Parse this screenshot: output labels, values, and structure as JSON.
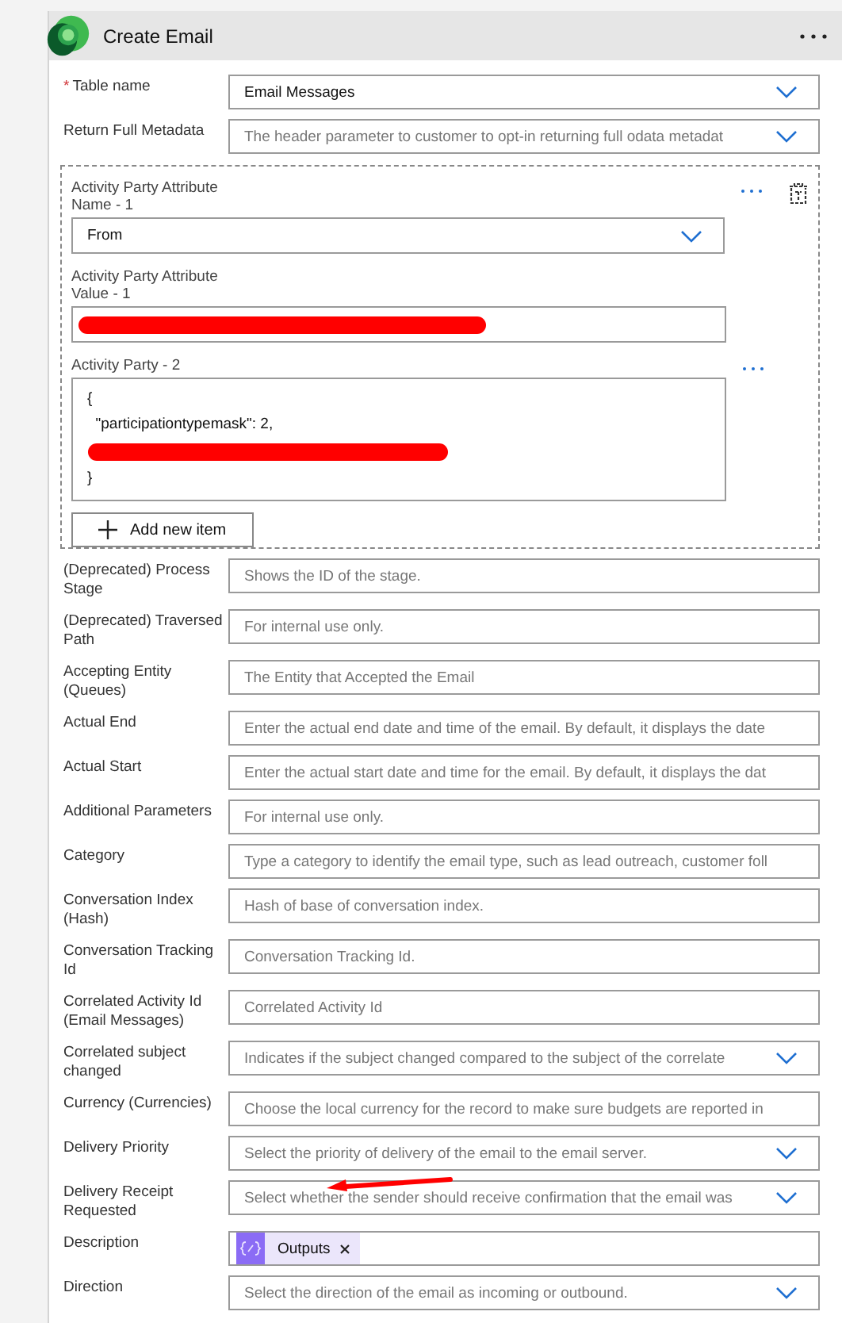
{
  "card": {
    "title": "Create Email"
  },
  "top_fields": [
    {
      "label": "Table name",
      "required_mark": "*",
      "kind": "dropdown",
      "value": "Email Messages"
    },
    {
      "label": "Return Full Metadata",
      "kind": "dropdown",
      "placeholder": "The header parameter to customer to opt-in returning full odata metadat"
    }
  ],
  "activity_party": {
    "items": [
      {
        "label": "Activity Party Attribute Name - 1",
        "kind": "dropdown",
        "value": "From"
      },
      {
        "label": "Activity Party Attribute Value - 1",
        "kind": "text"
      },
      {
        "label": "Activity Party - 2",
        "kind": "json",
        "lines": [
          "{",
          "  \"participationtypemask\": 2,",
          "}"
        ]
      }
    ],
    "add_button": "Add new item"
  },
  "fields": [
    {
      "label": "(Deprecated) Process Stage",
      "kind": "text",
      "placeholder": "Shows the ID of the stage."
    },
    {
      "label": "(Deprecated) Traversed Path",
      "kind": "text",
      "placeholder": "For internal use only."
    },
    {
      "label": "Accepting Entity (Queues)",
      "kind": "text",
      "placeholder": "The Entity that Accepted the Email"
    },
    {
      "label": "Actual End",
      "kind": "text",
      "placeholder": "Enter the actual end date and time of the email. By default, it displays the date"
    },
    {
      "label": "Actual Start",
      "kind": "text",
      "placeholder": "Enter the actual start date and time for the email. By default, it displays the dat"
    },
    {
      "label": "Additional Parameters",
      "kind": "text",
      "placeholder": "For internal use only."
    },
    {
      "label": "Category",
      "kind": "text",
      "placeholder": "Type a category to identify the email type, such as lead outreach, customer foll"
    },
    {
      "label": "Conversation Index (Hash)",
      "kind": "text",
      "placeholder": "Hash of base of conversation index."
    },
    {
      "label": "Conversation Tracking Id",
      "kind": "text",
      "placeholder": "Conversation Tracking Id."
    },
    {
      "label": "Correlated Activity Id (Email Messages)",
      "kind": "text",
      "placeholder": "Correlated Activity Id"
    },
    {
      "label": "Correlated subject changed",
      "kind": "dropdown",
      "placeholder": "Indicates if the subject changed compared to the subject of the correlate"
    },
    {
      "label": "Currency (Currencies)",
      "kind": "text",
      "placeholder": "Choose the local currency for the record to make sure budgets are reported in"
    },
    {
      "label": "Delivery Priority",
      "kind": "dropdown",
      "placeholder": "Select the priority of delivery of the email to the email server."
    },
    {
      "label": "Delivery Receipt Requested",
      "kind": "dropdown",
      "placeholder": "Select whether the sender should receive confirmation that the email was"
    },
    {
      "label": "Description",
      "kind": "token",
      "token": "Outputs"
    },
    {
      "label": "Direction",
      "kind": "dropdown",
      "placeholder": "Select the direction of the email as incoming or outbound."
    }
  ]
}
